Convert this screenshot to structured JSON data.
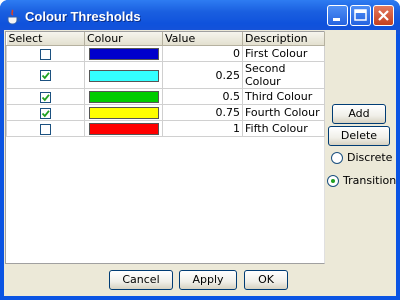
{
  "window": {
    "title": "Colour Thresholds",
    "icon": "java-coffee-icon",
    "controls": [
      "minimize-icon",
      "maximize-icon",
      "close-icon"
    ]
  },
  "table": {
    "headers": [
      "Select",
      "Colour",
      "Value",
      "Description"
    ],
    "rows": [
      {
        "selected": false,
        "color": "#0000cc",
        "value": "0",
        "description": "First Colour"
      },
      {
        "selected": true,
        "color": "#33ffff",
        "value": "0.25",
        "description": "Second Colour"
      },
      {
        "selected": true,
        "color": "#00cc00",
        "value": "0.5",
        "description": "Third Colour"
      },
      {
        "selected": true,
        "color": "#ffff00",
        "value": "0.75",
        "description": "Fourth Colour"
      },
      {
        "selected": false,
        "color": "#ff0000",
        "value": "1",
        "description": "Fifth Colour"
      }
    ]
  },
  "side": {
    "add_label": "Add",
    "delete_label": "Delete",
    "discrete_label": "Discrete",
    "transition_label": "Transition",
    "selected_mode": "Transition"
  },
  "footer": {
    "cancel_label": "Cancel",
    "apply_label": "Apply",
    "ok_label": "OK"
  }
}
